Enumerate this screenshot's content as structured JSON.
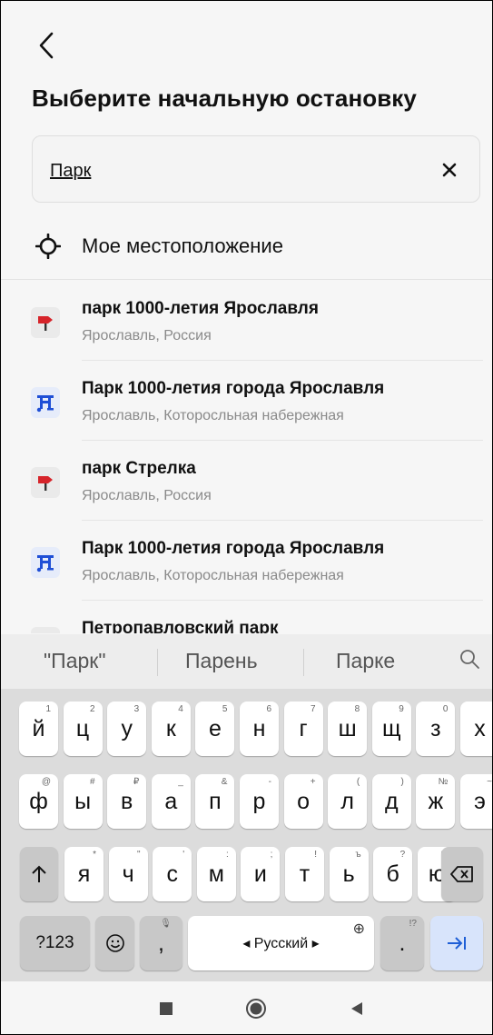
{
  "header": {
    "title": "Выберите начальную остановку"
  },
  "search": {
    "value": "Парк"
  },
  "my_location": {
    "label": "Мое местоположение"
  },
  "results": [
    {
      "name": "парк 1000-летия Ярославля",
      "address": "Ярославль, Россия",
      "icon": "signpost-icon"
    },
    {
      "name": "Парк 1000-летия города Ярославля",
      "address": "Ярославль, Которосльная набережная",
      "icon": "tram-stop-icon"
    },
    {
      "name": "парк Стрелка",
      "address": "Ярославль, Россия",
      "icon": "signpost-icon"
    },
    {
      "name": "Парк 1000-летия города Ярославля",
      "address": "Ярославль, Которосльная набережная",
      "icon": "tram-stop-icon"
    },
    {
      "name": "Петропавловский парк",
      "address": "",
      "icon": "signpost-icon"
    }
  ],
  "suggestions": [
    "\"Парк\"",
    "Парень",
    "Парке"
  ],
  "keyboard": {
    "row1": [
      {
        "k": "й",
        "h": "1"
      },
      {
        "k": "ц",
        "h": "2"
      },
      {
        "k": "у",
        "h": "3"
      },
      {
        "k": "к",
        "h": "4"
      },
      {
        "k": "е",
        "h": "5"
      },
      {
        "k": "н",
        "h": "6"
      },
      {
        "k": "г",
        "h": "7"
      },
      {
        "k": "ш",
        "h": "8"
      },
      {
        "k": "щ",
        "h": "9"
      },
      {
        "k": "з",
        "h": "0"
      },
      {
        "k": "х",
        "h": ""
      }
    ],
    "row2": [
      {
        "k": "ф",
        "h": "@"
      },
      {
        "k": "ы",
        "h": "#"
      },
      {
        "k": "в",
        "h": "₽"
      },
      {
        "k": "а",
        "h": "_"
      },
      {
        "k": "п",
        "h": "&"
      },
      {
        "k": "р",
        "h": "-"
      },
      {
        "k": "о",
        "h": "+"
      },
      {
        "k": "л",
        "h": "("
      },
      {
        "k": "д",
        "h": ")"
      },
      {
        "k": "ж",
        "h": "№"
      },
      {
        "k": "э",
        "h": "~"
      }
    ],
    "row3": [
      {
        "k": "я",
        "h": "*"
      },
      {
        "k": "ч",
        "h": "\""
      },
      {
        "k": "с",
        "h": "'"
      },
      {
        "k": "м",
        "h": ":"
      },
      {
        "k": "и",
        "h": ";"
      },
      {
        "k": "т",
        "h": "!"
      },
      {
        "k": "ь",
        "h": "ъ"
      },
      {
        "k": "б",
        "h": "?"
      },
      {
        "k": "ю",
        "h": "%"
      }
    ],
    "symbols_label": "?123",
    "comma": ",",
    "space_label": "◂ Русский ▸",
    "period": ".",
    "period_hint": "!?"
  }
}
